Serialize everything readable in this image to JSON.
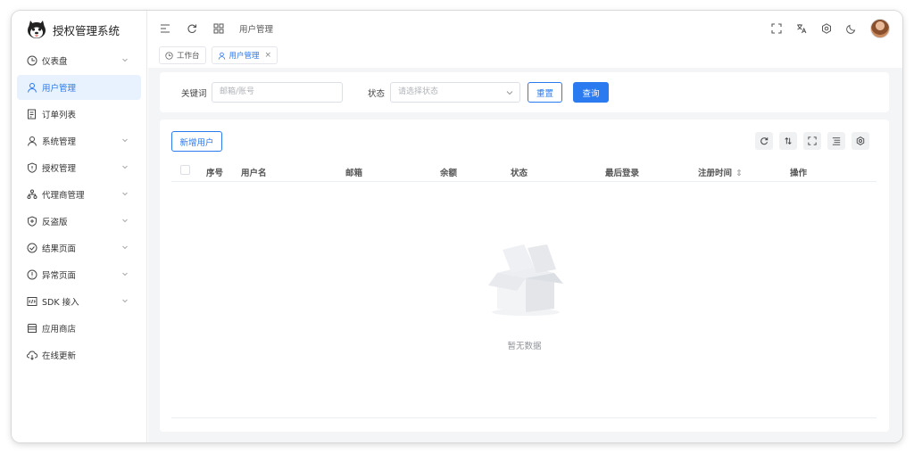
{
  "app": {
    "title": "授权管理系统"
  },
  "sidebar": {
    "items": [
      {
        "label": "仪表盘",
        "icon": "dashboard-icon",
        "has_children": true,
        "active": false
      },
      {
        "label": "用户管理",
        "icon": "user-icon",
        "has_children": false,
        "active": true
      },
      {
        "label": "订单列表",
        "icon": "order-icon",
        "has_children": false,
        "active": false
      },
      {
        "label": "系统管理",
        "icon": "system-user-icon",
        "has_children": true,
        "active": false
      },
      {
        "label": "授权管理",
        "icon": "shield-icon",
        "has_children": true,
        "active": false
      },
      {
        "label": "代理商管理",
        "icon": "org-icon",
        "has_children": true,
        "active": false
      },
      {
        "label": "反盗版",
        "icon": "shield-plus-icon",
        "has_children": true,
        "active": false
      },
      {
        "label": "结果页面",
        "icon": "check-circle-icon",
        "has_children": true,
        "active": false
      },
      {
        "label": "异常页面",
        "icon": "warning-circle-icon",
        "has_children": true,
        "active": false
      },
      {
        "label": "SDK 接入",
        "icon": "code-icon",
        "has_children": true,
        "active": false
      },
      {
        "label": "应用商店",
        "icon": "store-icon",
        "has_children": false,
        "active": false
      },
      {
        "label": "在线更新",
        "icon": "cloud-download-icon",
        "has_children": false,
        "active": false
      }
    ]
  },
  "header": {
    "breadcrumb": "用户管理"
  },
  "tabs": [
    {
      "label": "工作台",
      "active": false,
      "closable": false
    },
    {
      "label": "用户管理",
      "active": true,
      "closable": true,
      "close_glyph": "×"
    }
  ],
  "search": {
    "keyword_label": "关键词",
    "keyword_placeholder": "邮箱/账号",
    "status_label": "状态",
    "status_placeholder": "请选择状态",
    "reset_label": "重置",
    "query_label": "查询"
  },
  "table": {
    "add_button": "新增用户",
    "columns": [
      "序号",
      "用户名",
      "邮箱",
      "余额",
      "状态",
      "最后登录",
      "注册时间",
      "操作"
    ],
    "sortable_glyph": "⇕",
    "rows": [],
    "empty_text": "暂无数据"
  },
  "colors": {
    "primary": "#2b7af0",
    "active_bg": "#e8f1fe"
  }
}
